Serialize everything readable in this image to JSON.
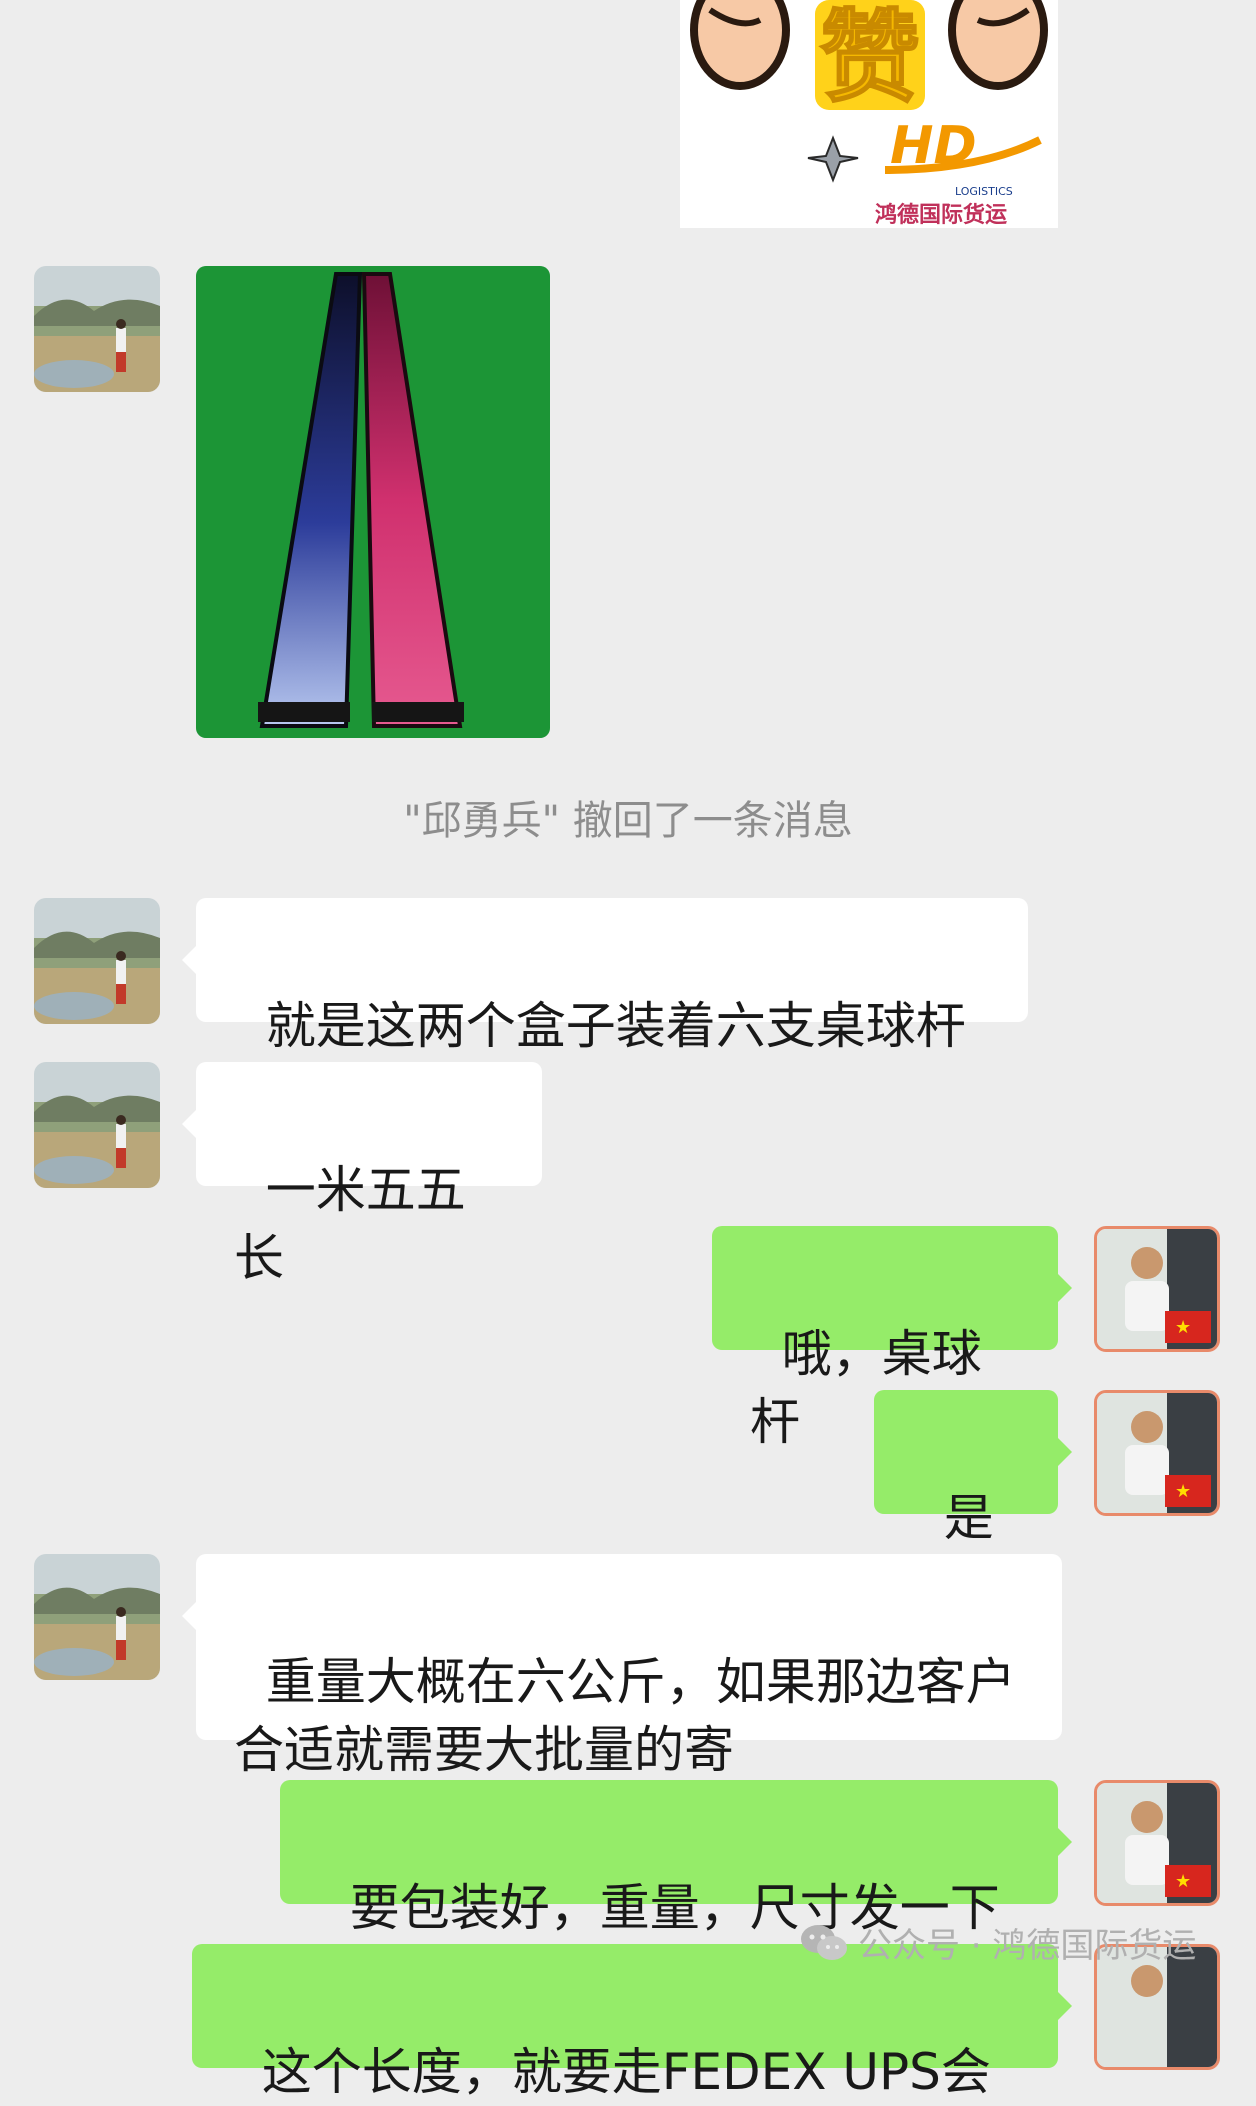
{
  "sticker": {
    "top_text": "赞",
    "brand_mark": "HD",
    "brand_sub": "LOGISTICS",
    "brand_cn": "鸿德国际货运"
  },
  "system_notice": "\"邱勇兵\" 撤回了一条消息",
  "messages": [
    {
      "side": "in",
      "text": "就是这两个盒子装着六支桌球杆"
    },
    {
      "side": "in",
      "text": "一米五五长"
    },
    {
      "side": "out",
      "text": "哦，桌球杆"
    },
    {
      "side": "out",
      "text": "是吗"
    },
    {
      "side": "in",
      "text": "重量大概在六公斤，如果那边客户\n合适就需要大批量的寄"
    },
    {
      "side": "out",
      "text": "要包装好，重量，尺寸发一下"
    },
    {
      "side": "out",
      "text": "这个长度，就要走FEDEX UPS会"
    }
  ],
  "watermark": {
    "icon": "wechat-icon",
    "text": "公众号 · 鸿德国际货运"
  },
  "colors": {
    "background": "#ededed",
    "incoming_bubble": "#ffffff",
    "outgoing_bubble": "#95ec69",
    "table_green": "#1f9a3a"
  }
}
